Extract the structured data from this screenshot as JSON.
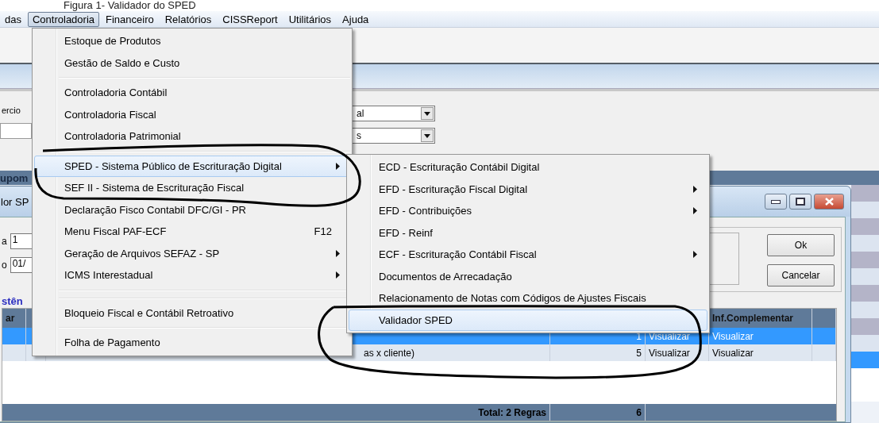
{
  "caption": "Figura 1- Validador do SPED",
  "menubar": [
    {
      "label": "das",
      "selected": false
    },
    {
      "label": "Controladoria",
      "selected": true
    },
    {
      "label": "Financeiro",
      "selected": false
    },
    {
      "label": "Relatórios",
      "selected": false
    },
    {
      "label": "CISSReport",
      "selected": false
    },
    {
      "label": "Utilitários",
      "selected": false
    },
    {
      "label": "Ajuda",
      "selected": false
    }
  ],
  "filter_form": {
    "label": "ercio",
    "combos": [
      "al",
      "s"
    ]
  },
  "section_header": "upom",
  "dialog": {
    "title": "lor SP",
    "fields": [
      {
        "label": "a",
        "value": "1"
      },
      {
        "label": "o",
        "value": "01/"
      }
    ],
    "buttons": [
      "Ok",
      "Cancelar"
    ],
    "group_label": "stên",
    "table": {
      "header": {
        "first": "ar",
        "info": "Inf.Complementar"
      },
      "rows": [
        {
          "selected": true,
          "count": "1",
          "view": "Visualizar",
          "info": "Visualizar"
        },
        {
          "selected": false,
          "description": "as x cliente)",
          "count": "5",
          "view": "Visualizar",
          "info": "Visualizar"
        }
      ]
    },
    "footer": {
      "total": "Total: 2 Regras",
      "count": "6"
    }
  },
  "menu": {
    "items": [
      {
        "kind": "item",
        "label": "Estoque de Produtos",
        "submenu": false,
        "selected": false
      },
      {
        "kind": "item",
        "label": "Gestão de Saldo e Custo",
        "submenu": false,
        "selected": false
      },
      {
        "kind": "separator"
      },
      {
        "kind": "item",
        "label": "Controladoria Contábil",
        "submenu": false,
        "selected": false
      },
      {
        "kind": "item",
        "label": "Controladoria Fiscal",
        "submenu": false,
        "selected": false
      },
      {
        "kind": "item",
        "label": "Controladoria Patrimonial",
        "submenu": false,
        "selected": false
      },
      {
        "kind": "separator"
      },
      {
        "kind": "item",
        "label": "SPED - Sistema Público de Escrituração Digital",
        "submenu": true,
        "selected": true
      },
      {
        "kind": "item",
        "label": "SEF II - Sistema de Escrituração Fiscal",
        "submenu": false,
        "selected": false
      },
      {
        "kind": "item",
        "label": "Declaração Fisco Contabil DFC/GI - PR",
        "submenu": false,
        "selected": false
      },
      {
        "kind": "item",
        "label": "Menu Fiscal PAF-ECF",
        "shortcut": "F12",
        "submenu": false,
        "selected": false
      },
      {
        "kind": "item",
        "label": "Geração de Arquivos SEFAZ - SP",
        "submenu": true,
        "selected": false
      },
      {
        "kind": "item",
        "label": "ICMS Interestadual",
        "submenu": true,
        "selected": false
      },
      {
        "kind": "gap"
      },
      {
        "kind": "item",
        "label": "Bloqueio Fiscal e Contábil Retroativo",
        "submenu": false,
        "selected": false
      },
      {
        "kind": "separator"
      },
      {
        "kind": "item",
        "label": "Folha de Pagamento",
        "submenu": false,
        "selected": false
      }
    ]
  },
  "submenu": {
    "items": [
      {
        "kind": "item",
        "label": "ECD - Escrituração Contábil Digital",
        "submenu": false,
        "selected": false
      },
      {
        "kind": "item",
        "label": "EFD - Escrituração Fiscal Digital",
        "submenu": true,
        "selected": false
      },
      {
        "kind": "item",
        "label": "EFD - Contribuições",
        "submenu": true,
        "selected": false
      },
      {
        "kind": "item",
        "label": "EFD - Reinf",
        "submenu": false,
        "selected": false
      },
      {
        "kind": "item",
        "label": "ECF - Escrituração Contábil Fiscal",
        "submenu": true,
        "selected": false
      },
      {
        "kind": "item",
        "label": "Documentos de Arrecadação",
        "submenu": false,
        "selected": false
      },
      {
        "kind": "item",
        "label": "Relacionamento de Notas com Códigos de Ajustes Fiscais",
        "submenu": false,
        "selected": false
      },
      {
        "kind": "item",
        "label": "Validador SPED",
        "submenu": false,
        "selected": true
      }
    ]
  }
}
